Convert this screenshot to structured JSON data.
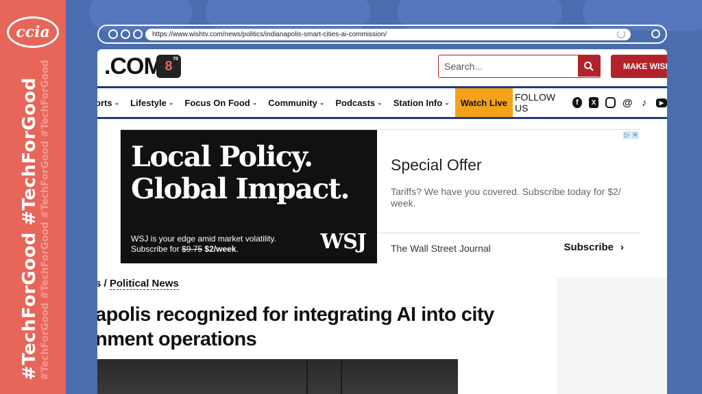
{
  "brand": {
    "logo_text": "ccia",
    "hashtag": "#TechForGood"
  },
  "browser": {
    "url": "https://www.wishtv.com/news/politics/indianapolis-smart-cities-ai-commission/"
  },
  "site": {
    "logo_text": ".COM",
    "badge_text": "8",
    "badge_small": "70",
    "search_placeholder": "Search...",
    "cta_label": "MAKE WISHTV",
    "nav": [
      {
        "label": "orts"
      },
      {
        "label": "Lifestyle"
      },
      {
        "label": "Focus On Food"
      },
      {
        "label": "Community"
      },
      {
        "label": "Podcasts"
      },
      {
        "label": "Station Info"
      }
    ],
    "watch_live": "Watch Live",
    "follow_label": "FOLLOW US",
    "social_icons": [
      "facebook-icon",
      "x-icon",
      "instagram-icon",
      "threads-icon",
      "tiktok-icon",
      "youtube-icon"
    ]
  },
  "ad": {
    "headline_1": "Local Policy.",
    "headline_2": "Global Impact.",
    "sub_line_1": "WSJ is your edge amid market volatility.",
    "sub_prefix": "Subscribe for ",
    "old_price": "$9.75",
    "new_price": "$2/week",
    "sub_suffix": ".",
    "logo": "WSJ",
    "offer_title": "Special Offer",
    "offer_text": "Tariffs? We have you covered. Subscribe today for $2/ week.",
    "publisher": "The Wall Street Journal",
    "subscribe_label": "Subscribe",
    "colors": {
      "dark": "#111111"
    }
  },
  "article": {
    "breadcrumb_prefix": "s / ",
    "breadcrumb_link": "Political News",
    "title_line_1": "apolis recognized for integrating AI into city",
    "title_line_2": "nment operations"
  },
  "colors": {
    "background": "#4a6db0",
    "banner": "#e8655a",
    "brand_red": "#b3222a",
    "nav_blue": "#1b3a80",
    "watch_live": "#f5a21b"
  }
}
